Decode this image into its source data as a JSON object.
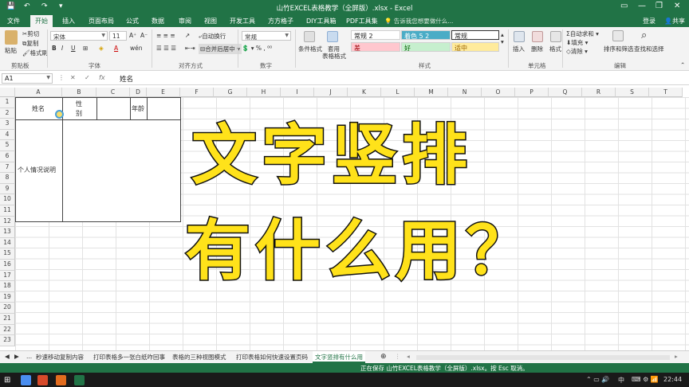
{
  "window": {
    "title": "山竹EXCEL表格教学（全屏版）.xlsx - Excel"
  },
  "menu": {
    "tabs": [
      "文件",
      "开始",
      "插入",
      "页面布局",
      "公式",
      "数据",
      "审阅",
      "视图",
      "开发工具",
      "方方格子",
      "DIY工具箱",
      "PDF工具集"
    ],
    "active_tab": "开始",
    "tell_me": "告诉我您想要做什么...",
    "login": "登录",
    "share": "共享"
  },
  "ribbon": {
    "clipboard": {
      "paste": "粘贴",
      "cut": "剪切",
      "copy": "复制",
      "format_painter": "格式刷",
      "label": "剪贴板"
    },
    "font": {
      "name": "宋体",
      "size": "11",
      "bold": "B",
      "italic": "I",
      "underline": "U",
      "label": "字体"
    },
    "alignment": {
      "wrap": "自动换行",
      "merge": "合并后居中",
      "label": "对齐方式"
    },
    "number": {
      "format": "常规",
      "label": "数字"
    },
    "styles": {
      "conditional": "条件格式",
      "table": "套用",
      "table2": "表格格式",
      "normal2": "常规 2",
      "accent": "着色 5 2",
      "normal": "常规",
      "bad": "差",
      "good": "好",
      "neutral": "适中",
      "label": "样式"
    },
    "cells": {
      "insert": "插入",
      "delete": "删除",
      "format": "格式",
      "label": "单元格"
    },
    "editing": {
      "autosum": "自动求和",
      "fill": "填充",
      "clear": "清除",
      "sort": "排序和筛选",
      "find": "查找和选择",
      "label": "编辑"
    }
  },
  "formula_bar": {
    "name_box": "A1",
    "fx": "fx",
    "content": "姓名"
  },
  "grid": {
    "columns": [
      "A",
      "B",
      "C",
      "D",
      "E",
      "F",
      "G",
      "H",
      "I",
      "J",
      "K",
      "L",
      "M",
      "N",
      "O",
      "P",
      "Q",
      "R",
      "S",
      "T"
    ],
    "rows": [
      "1",
      "2",
      "3",
      "4",
      "5",
      "6",
      "7",
      "8",
      "9",
      "10",
      "11",
      "12",
      "13",
      "14",
      "15",
      "16",
      "17",
      "18",
      "19",
      "20",
      "21",
      "22",
      "23"
    ],
    "cells": {
      "name": "姓名",
      "gender1": "性",
      "gender2": "别",
      "age": "年龄",
      "personal": "个人情况说明"
    }
  },
  "overlay": {
    "line1": "文字竖排",
    "line2": "有什么用？"
  },
  "sheet_tabs": {
    "nav": "...",
    "tabs": [
      "秒速移动复制内容",
      "打印表格多一张白纸咋回事",
      "表格的三种视图模式",
      "打印表格如何快速设置页码",
      "文字竖排有什么用"
    ],
    "active": "文字竖排有什么用"
  },
  "status_bar": {
    "text": "正在保存 山竹EXCEL表格教学（全屏版）.xlsx。按 Esc 取消。"
  },
  "taskbar": {
    "clock": "22:44",
    "ime": "中"
  },
  "colors": {
    "excel_green": "#217346",
    "overlay_yellow": "#ffe21a"
  }
}
